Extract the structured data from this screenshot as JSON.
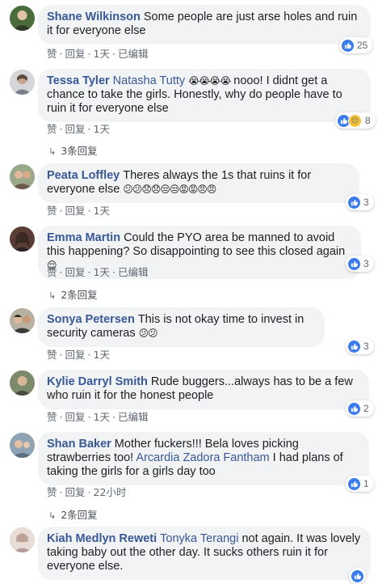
{
  "actions": {
    "like": "赞",
    "reply": "回复",
    "dot": "·",
    "edited": "已编辑"
  },
  "comments": [
    {
      "author": "Shane Wilkinson",
      "text": "Some people are just arse holes and ruin it for everyone else",
      "time": "1天",
      "edited": true,
      "reactions": "25",
      "avatar_color": "#4a6b3a"
    },
    {
      "author": "Tessa Tyler",
      "mention": "Natasha Tutty",
      "emoji": "😭😭😭😭",
      "text": "nooo! I didnt get a chance to take the girls. Honestly, why do people have to ruin it for everyone else",
      "time": "1天",
      "edited": false,
      "reactions": "8",
      "replies": "3条回复",
      "avatar_color": "#8a8f99"
    },
    {
      "author": "Peata Loffley",
      "text": "Theres always the 1s that ruins it for everyone else",
      "emoji": "😕😕😞😞😒😒😡😡😠😠",
      "time": "1天",
      "edited": false,
      "reactions": "3",
      "avatar_color": "#6d5a4a"
    },
    {
      "author": "Emma Martin",
      "text": "Could the PYO area be manned to avoid this happening? So disappointing to see this closed again",
      "emoji": "😌",
      "time": "1天",
      "edited": true,
      "reactions": "3",
      "replies": "2条回复",
      "avatar_color": "#5a3d35"
    },
    {
      "author": "Sonya Petersen",
      "text": "This is not okay time to invest in security cameras",
      "emoji": "😕😕",
      "time": "1天",
      "edited": false,
      "reactions": "3",
      "avatar_color": "#3c3a3a"
    },
    {
      "author": "Kylie Darryl Smith",
      "text": "Rude buggers...always has to be a few who ruin it for the honest people",
      "time": "1天",
      "edited": true,
      "reactions": "2",
      "avatar_color": "#7b8a6a"
    },
    {
      "author": "Shan Baker",
      "text": "Mother fuckers!!! Bela loves picking strawberries too!",
      "mention": "Arcardia Zadora Fantham",
      "text2": "I had plans of taking the girls for a girls day too",
      "time": "22小时",
      "edited": false,
      "reactions": "1",
      "replies": "2条回复",
      "avatar_color": "#5b6f80"
    },
    {
      "author": "Kiah Medlyn Reweti",
      "mention": "Tonyka Terangi",
      "text": "not again. It was lovely taking baby out the other day. It sucks others ruin it for everyone else.",
      "reactions": "",
      "avatar_color": "#a08a8a"
    }
  ]
}
